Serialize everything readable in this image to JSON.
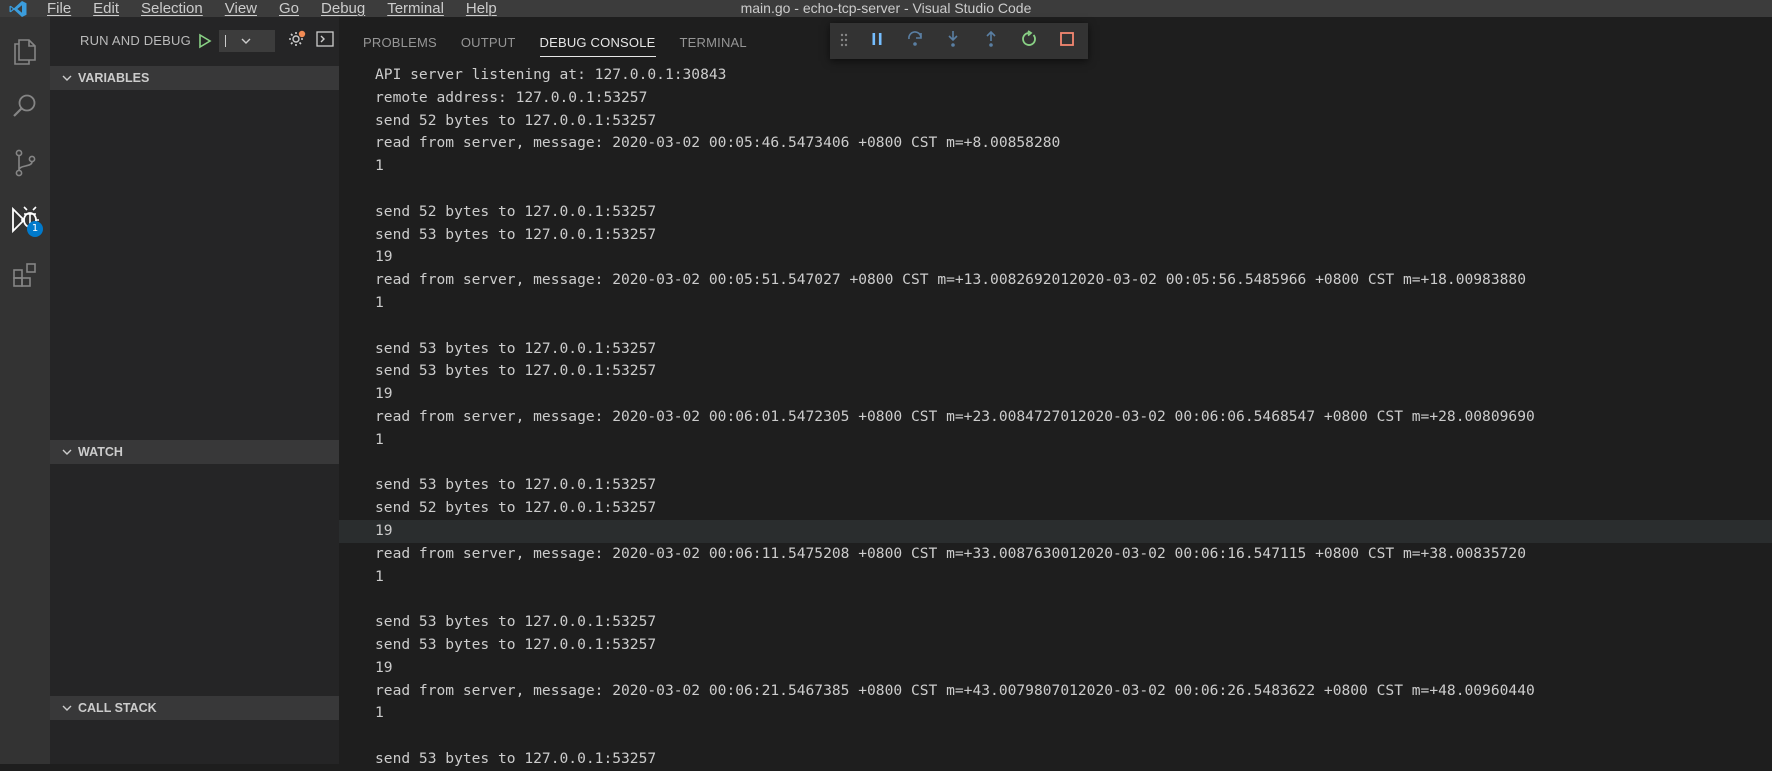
{
  "window": {
    "title": "main.go - echo-tcp-server - Visual Studio Code",
    "menu": [
      "File",
      "Edit",
      "Selection",
      "View",
      "Go",
      "Debug",
      "Terminal",
      "Help"
    ]
  },
  "activity_bar": {
    "items": [
      {
        "name": "explorer",
        "icon": "files-icon"
      },
      {
        "name": "search",
        "icon": "search-icon"
      },
      {
        "name": "source-control",
        "icon": "source-control-icon"
      },
      {
        "name": "run-debug",
        "icon": "debug-icon",
        "badge": "1"
      },
      {
        "name": "extensions",
        "icon": "extensions-icon"
      }
    ]
  },
  "sidebar": {
    "title": "RUN AND DEBUG",
    "config_value": "",
    "sections": [
      {
        "label": "VARIABLES",
        "expanded": true
      },
      {
        "label": "WATCH",
        "expanded": true
      },
      {
        "label": "CALL STACK",
        "expanded": true
      }
    ]
  },
  "panel": {
    "tabs": [
      {
        "label": "PROBLEMS",
        "active": false
      },
      {
        "label": "OUTPUT",
        "active": false
      },
      {
        "label": "DEBUG CONSOLE",
        "active": true
      },
      {
        "label": "TERMINAL",
        "active": false
      }
    ]
  },
  "debug_toolbar": {
    "buttons": [
      "pause-icon",
      "step-over-icon",
      "step-into-icon",
      "step-out-icon",
      "restart-icon",
      "stop-icon"
    ]
  },
  "colors": {
    "accent": "#007acc",
    "continue_green": "#89d185",
    "stop_red": "#f48771",
    "debug_blue": "#75beff"
  },
  "console": {
    "highlighted_line": 20,
    "lines": [
      "API server listening at: 127.0.0.1:30843",
      "remote address: 127.0.0.1:53257",
      "send 52 bytes to 127.0.0.1:53257",
      "read from server, message: 2020-03-02 00:05:46.5473406 +0800 CST m=+8.00858280",
      "1",
      "",
      "send 52 bytes to 127.0.0.1:53257",
      "send 53 bytes to 127.0.0.1:53257",
      "19",
      "read from server, message: 2020-03-02 00:05:51.547027 +0800 CST m=+13.0082692012020-03-02 00:05:56.5485966 +0800 CST m=+18.00983880",
      "1",
      "",
      "send 53 bytes to 127.0.0.1:53257",
      "send 53 bytes to 127.0.0.1:53257",
      "19",
      "read from server, message: 2020-03-02 00:06:01.5472305 +0800 CST m=+23.0084727012020-03-02 00:06:06.5468547 +0800 CST m=+28.00809690",
      "1",
      "",
      "send 53 bytes to 127.0.0.1:53257",
      "send 52 bytes to 127.0.0.1:53257",
      "19",
      "read from server, message: 2020-03-02 00:06:11.5475208 +0800 CST m=+33.0087630012020-03-02 00:06:16.547115 +0800 CST m=+38.00835720",
      "1",
      "",
      "send 53 bytes to 127.0.0.1:53257",
      "send 53 bytes to 127.0.0.1:53257",
      "19",
      "read from server, message: 2020-03-02 00:06:21.5467385 +0800 CST m=+43.0079807012020-03-02 00:06:26.5483622 +0800 CST m=+48.00960440",
      "1",
      "",
      "send 53 bytes to 127.0.0.1:53257"
    ]
  }
}
